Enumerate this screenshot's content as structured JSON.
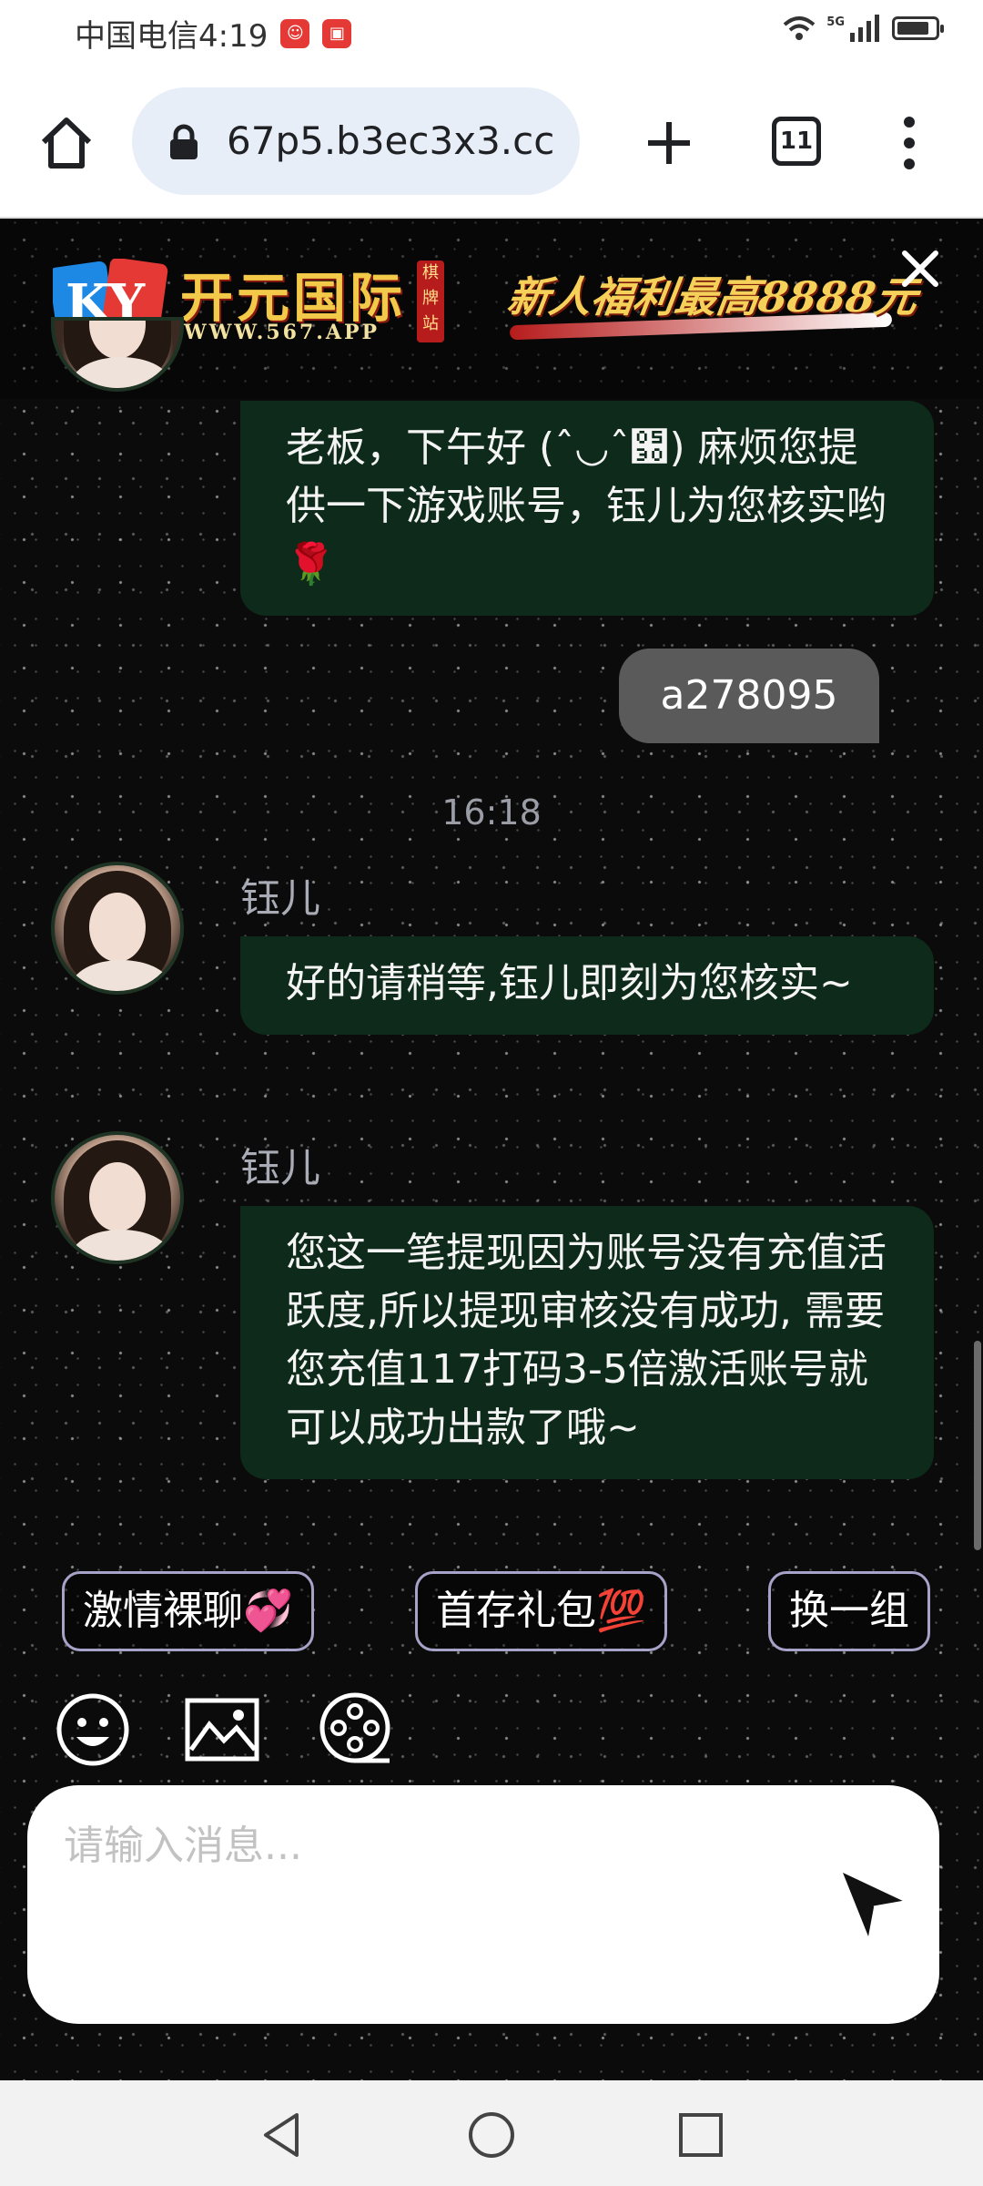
{
  "status_bar": {
    "carrier_time": "中国电信4:19",
    "network": "5G",
    "battery_level": 0.85,
    "colors": {
      "app_icon": "#e53935"
    }
  },
  "browser": {
    "url": "67p5.b3ec3x3.cc",
    "tab_count": "11",
    "icons": [
      "home-icon",
      "lock-icon",
      "plus-icon",
      "tabs-icon",
      "menu-icon"
    ]
  },
  "banner": {
    "logo": "KY",
    "brand": "开元国际",
    "badge": "棋牌站",
    "site": "WWW.567.APP",
    "promo": "新人福利最高8888元",
    "colors": {
      "gold": "#f3c94a",
      "red": "#b71c1c"
    }
  },
  "chat": {
    "messages": [
      {
        "sender": "",
        "text": "老板，下午好 (ˆ◡ˆ԰) 麻烦您提供一下游戏账号，钰儿为您核实哟🌹"
      },
      {
        "text": "a278095"
      },
      {
        "time": "16:18"
      },
      {
        "sender": "钰儿",
        "text": "好的请稍等,钰儿即刻为您核实~"
      },
      {
        "sender": "钰儿",
        "text": "您这一笔提现因为账号没有充值活跃度,所以提现审核没有成功, 需要您充值117打码3-5倍激活账号就可以成功出款了哦~"
      }
    ],
    "colors": {
      "incoming_bubble": "#0e2a1a",
      "outgoing_bubble": "#5a5a5a",
      "background": "#0b0b0b"
    }
  },
  "quick_replies": [
    "激情裸聊💞",
    "首存礼包💯",
    "换一组"
  ],
  "composer": {
    "placeholder": "请输入消息...",
    "icons": [
      "emoji-icon",
      "image-icon",
      "video-icon",
      "send-icon"
    ]
  },
  "nav": {
    "icons": [
      "back-icon",
      "home-circle-icon",
      "recents-icon"
    ]
  }
}
